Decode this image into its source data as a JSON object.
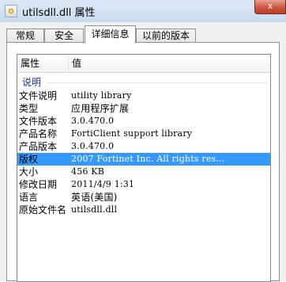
{
  "window": {
    "title": "utilsdll.dll 属性",
    "close_label": "x"
  },
  "tabs": [
    {
      "label": "常规"
    },
    {
      "label": "安全"
    },
    {
      "label": "详细信息",
      "active": true
    },
    {
      "label": "以前的版本"
    }
  ],
  "details": {
    "columns": {
      "property": "属性",
      "value": "值"
    },
    "group": "说明",
    "rows": [
      {
        "key": "文件说明",
        "value": "utility library"
      },
      {
        "key": "类型",
        "value": "应用程序扩展"
      },
      {
        "key": "文件版本",
        "value": "3.0.470.0"
      },
      {
        "key": "产品名称",
        "value": "FortiClient support library"
      },
      {
        "key": "产品版本",
        "value": "3.0.470.0"
      },
      {
        "key": "版权",
        "value": "2007 Fortinet Inc. All rights res...",
        "selected": true
      },
      {
        "key": "大小",
        "value": "456 KB"
      },
      {
        "key": "修改日期",
        "value": "2011/4/9 1:31"
      },
      {
        "key": "语言",
        "value": "英语(美国)"
      },
      {
        "key": "原始文件名",
        "value": "utilsdll.dll"
      }
    ]
  },
  "colors": {
    "selection": "#3399ff",
    "group_text": "#1e3287"
  }
}
